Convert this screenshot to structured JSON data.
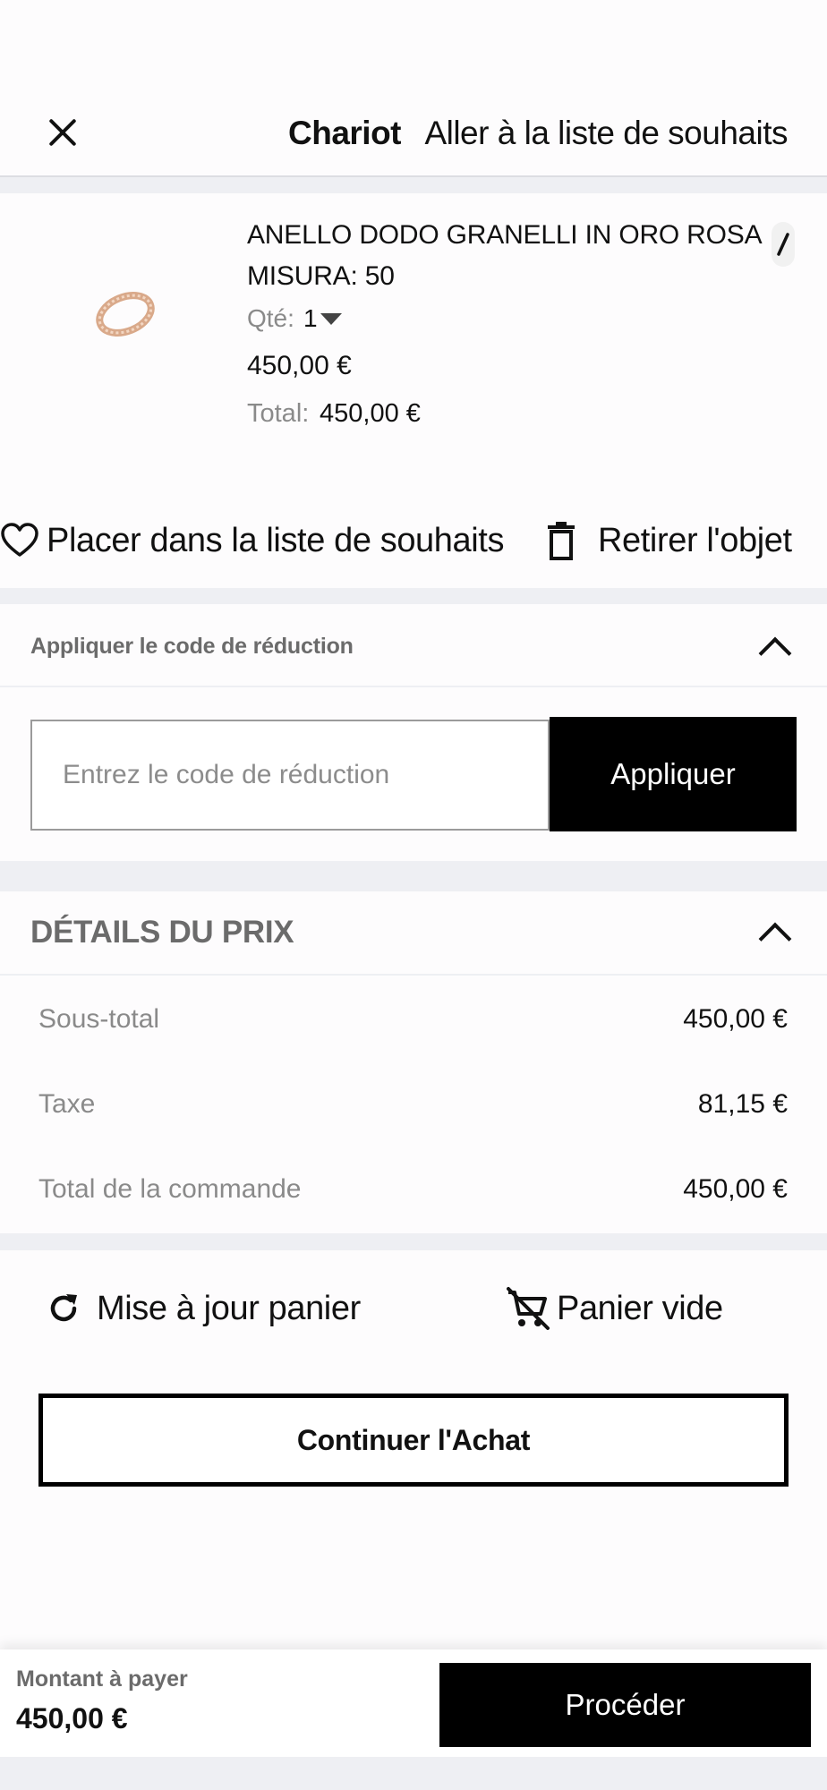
{
  "header": {
    "title": "Chariot",
    "wishlist_link": "Aller à la liste de souhaits"
  },
  "product": {
    "name": "ANELLO DODO GRANELLI IN ORO ROSA",
    "size": "MISURA: 50",
    "qty_label": "Qté:",
    "qty_value": "1",
    "price": "450,00 €",
    "total_label": "Total:",
    "total_value": "450,00 €",
    "image": "rose-gold-ring"
  },
  "item_actions": {
    "wishlist": "Placer dans la liste de souhaits",
    "remove": "Retirer l'objet"
  },
  "discount": {
    "title": "Appliquer le code de réduction",
    "placeholder": "Entrez le code de réduction",
    "apply": "Appliquer"
  },
  "price_details": {
    "title": "DÉTAILS DU PRIX",
    "rows": [
      {
        "label": "Sous-total",
        "value": "450,00 €"
      },
      {
        "label": "Taxe",
        "value": "81,15 €"
      },
      {
        "label": "Total de la commande",
        "value": "450,00 €"
      }
    ]
  },
  "cart_actions": {
    "update": "Mise à jour panier",
    "empty": "Panier vide",
    "continue": "Continuer l'Achat"
  },
  "footer": {
    "amount_label": "Montant à payer",
    "amount_value": "450,00 €",
    "proceed": "Procéder"
  },
  "colors": {
    "background": "#fdfcfd",
    "band": "#eeeff3",
    "primary_button": "#000000",
    "muted_text": "#8a8a8a"
  }
}
